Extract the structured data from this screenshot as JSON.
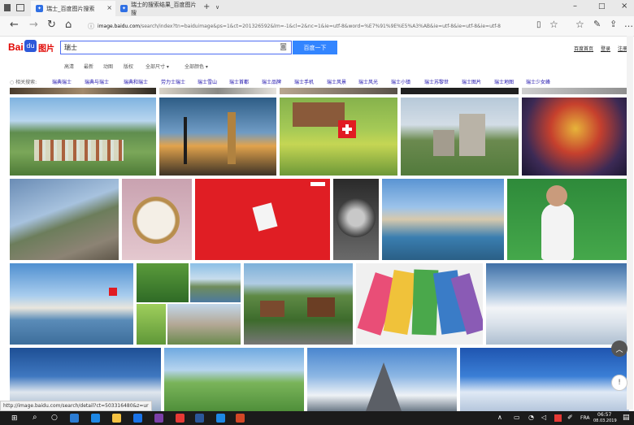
{
  "browser": {
    "tabs": [
      {
        "label": "瑞士_百度图片搜索",
        "active": true
      },
      {
        "label": "瑞士的搜索结果_百度图片搜",
        "active": false
      }
    ],
    "new_tab": "+",
    "tab_menu": "∨",
    "url_prefix": "image.baidu.com",
    "url_rest": "/search/index?tn=baiduimage&ps=1&ct=201326592&lm=-1&cl=2&nc=1&ie=utf-8&word=%E7%91%9E%E5%A3%AB&ie=utf-8&ie=utf-8&ie=utf-8",
    "window_controls": {
      "minimize": "–",
      "maximize": "□",
      "close": "×"
    }
  },
  "baidu": {
    "logo_text_1": "Bai",
    "logo_text_2": "du",
    "logo_text_3": "图片",
    "search_value": "瑞士",
    "search_button": "百度一下",
    "top_links": [
      "百度首页",
      "登录",
      "注册"
    ]
  },
  "filters": [
    "高清",
    "最新",
    "动图",
    "版权",
    "全部尺寸 ▾",
    "全部颜色 ▾"
  ],
  "related": {
    "label": "相关搜索:",
    "items": [
      "瑞典瑞士",
      "瑞典与瑞士",
      "瑞典和瑞士",
      "劳力士瑞士",
      "瑞士雪山",
      "瑞士首都",
      "瑞士品牌",
      "瑞士手机",
      "瑞士风景",
      "瑞士风光",
      "瑞士小镇",
      "瑞士苏黎世",
      "瑞士图片",
      "瑞士地图",
      "瑞士少女峰"
    ]
  },
  "status_url": "http://image.baidu.com/search/detail?ct=503316480&z=ur",
  "taskbar": {
    "lang": "FRA",
    "time": "06:57",
    "date": "08.03.2019"
  },
  "colors": {
    "baidu_blue": "#3385ff",
    "baidu_red": "#e10602",
    "link_blue": "#1a0dab"
  }
}
